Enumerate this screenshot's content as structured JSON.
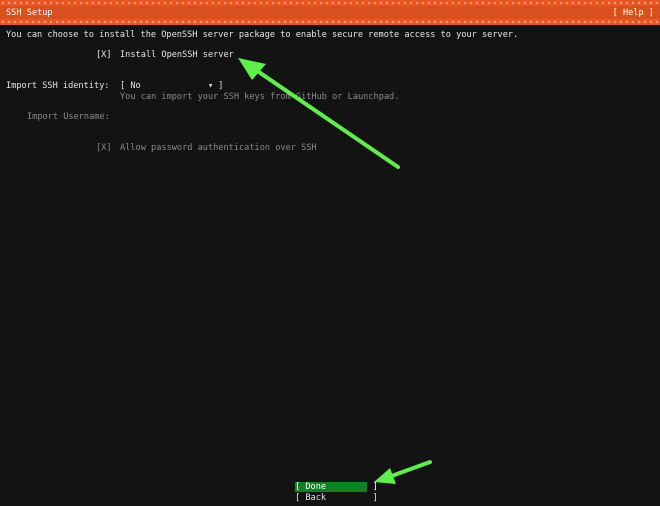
{
  "header": {
    "title": "SSH Setup",
    "help": "[ Help ]"
  },
  "intro_text": "You can choose to install the OpenSSH server package to enable secure remote access to your server.",
  "install_openssh": {
    "checkbox": "[X]",
    "label": "Install OpenSSH server",
    "checked": true
  },
  "import_identity": {
    "label": "Import SSH identity:",
    "select_value": "[ No             ▾ ]",
    "help_text": "You can import your SSH keys from GitHub or Launchpad."
  },
  "import_username": {
    "label": "Import Username:",
    "value": ""
  },
  "allow_password": {
    "checkbox": "[X]",
    "label": "Allow password authentication over SSH",
    "checked": true
  },
  "buttons": {
    "done": "[ Done         ]",
    "back": "[ Back         ]"
  },
  "colors": {
    "header": "#e95420",
    "background": "#131313",
    "focus": "#0e8420",
    "annotation_arrow": "#5ef04a"
  }
}
